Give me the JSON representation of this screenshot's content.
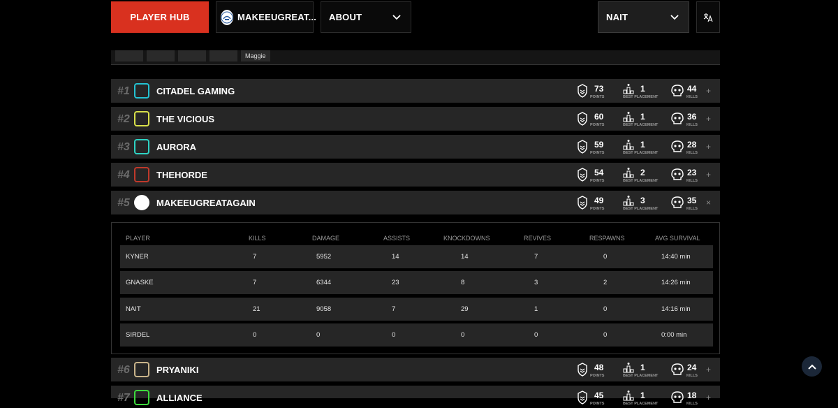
{
  "nav": {
    "player_hub": "PLAYER HUB",
    "team": "MAKEEUGREAT...",
    "about": "ABOUT",
    "user": "NAIT",
    "lang_icon": "translate-icon"
  },
  "strip": {
    "tag": "Maggie"
  },
  "labels": {
    "points": "POINTS",
    "best": "BEST PLACEMENT",
    "kills": "KILLS"
  },
  "teams": [
    {
      "rank": "#1",
      "name": "CITADEL GAMING",
      "points": "73",
      "best": "1",
      "kills": "44",
      "toggle": "+",
      "logo_color": "#24c2d2"
    },
    {
      "rank": "#2",
      "name": "THE VICIOUS",
      "points": "60",
      "best": "1",
      "kills": "36",
      "toggle": "+",
      "logo_color": "#d8e04a"
    },
    {
      "rank": "#3",
      "name": "AURORA",
      "points": "59",
      "best": "1",
      "kills": "28",
      "toggle": "+",
      "logo_color": "#2ed3c4"
    },
    {
      "rank": "#4",
      "name": "THEHORDE",
      "points": "54",
      "best": "2",
      "kills": "23",
      "toggle": "+",
      "logo_color": "#c0392b"
    },
    {
      "rank": "#5",
      "name": "MAKEEUGREATAGAIN",
      "points": "49",
      "best": "3",
      "kills": "35",
      "toggle": "×",
      "logo_color": "#ffffff"
    },
    {
      "rank": "#6",
      "name": "PRYANIKI",
      "points": "48",
      "best": "1",
      "kills": "24",
      "toggle": "+",
      "logo_color": "#c9b48a"
    },
    {
      "rank": "#7",
      "name": "ALLIANCE",
      "points": "45",
      "best": "1",
      "kills": "18",
      "toggle": "+",
      "logo_color": "#3ddc3d"
    }
  ],
  "detail": {
    "headers": [
      "PLAYER",
      "KILLS",
      "DAMAGE",
      "ASSISTS",
      "KNOCKDOWNS",
      "REVIVES",
      "RESPAWNS",
      "AVG SURVIVAL"
    ],
    "players": [
      [
        "KYNER",
        "7",
        "5952",
        "14",
        "14",
        "7",
        "0",
        "14:40 min"
      ],
      [
        "GNASKE",
        "7",
        "6344",
        "23",
        "8",
        "3",
        "2",
        "14:26 min"
      ],
      [
        "NAIT",
        "21",
        "9058",
        "7",
        "29",
        "1",
        "0",
        "14:16 min"
      ],
      [
        "SIRDEL",
        "0",
        "0",
        "0",
        "0",
        "0",
        "0",
        "0:00 min"
      ]
    ]
  },
  "colors": {
    "accent": "#d9311f",
    "row_bg": "#262626",
    "bg": "#000000"
  }
}
